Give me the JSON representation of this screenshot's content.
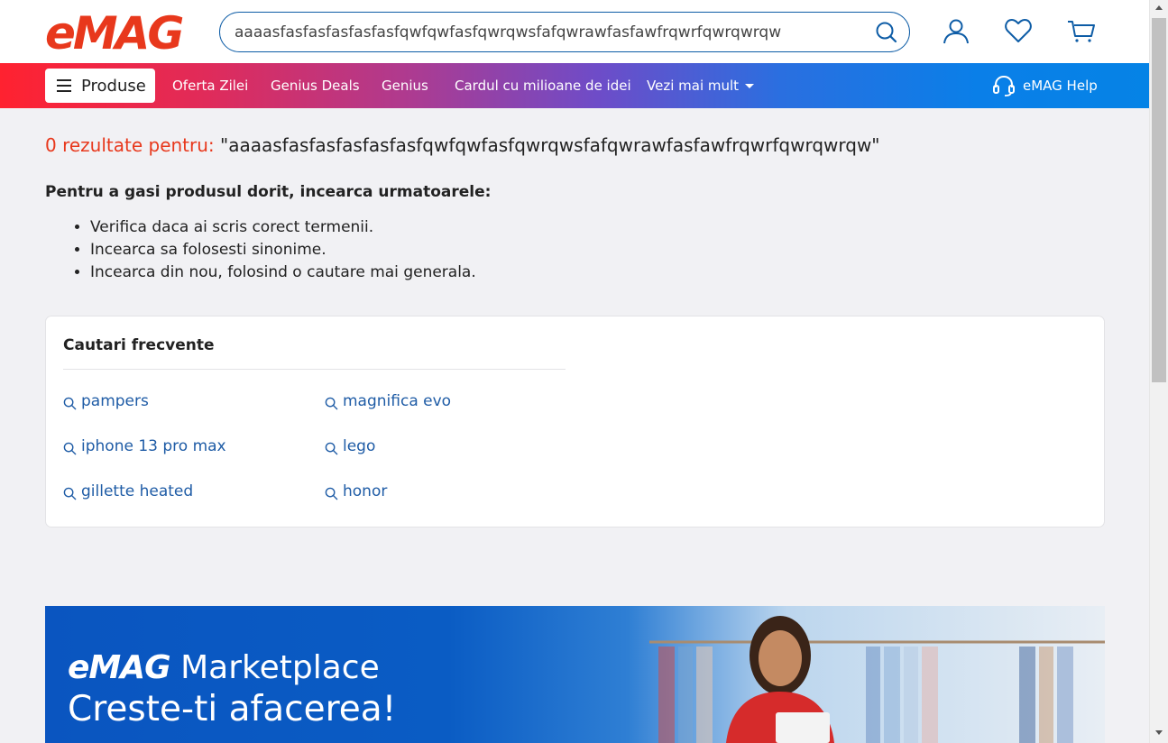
{
  "header": {
    "logo_text": "eMAG",
    "search_value": "aaaasfasfasfasfasfasfqwfqwfasfqwrqwsfafqwrawfasfawfrqwrfqwrqwrqw",
    "icons": [
      "search-icon",
      "user-icon",
      "heart-icon",
      "cart-icon"
    ]
  },
  "nav": {
    "produse": "Produse",
    "links": [
      "Oferta Zilei",
      "Genius Deals",
      "Genius",
      "Cardul cu milioane de idei",
      "Vezi mai mult"
    ],
    "help": "eMAG Help"
  },
  "results": {
    "count_label": "0 rezultate pentru:",
    "query_quoted": "\"aaaasfasfasfasfasfasfqwfqwfasfqwrqwsfafqwrawfasfawfrqwrfqwrqwrqw\""
  },
  "tips": {
    "title": "Pentru a gasi produsul dorit, incearca urmatoarele:",
    "items": [
      "Verifica daca ai scris corect termenii.",
      "Incearca sa folosesti sinonime.",
      "Incearca din nou, folosind o cautare mai generala."
    ]
  },
  "frequent": {
    "title": "Cautari frecvente",
    "items": [
      "pampers",
      "magnifica evo",
      "iphone 13 pro max",
      "lego",
      "gillette heated",
      "honor"
    ]
  },
  "banner": {
    "brand": "eMAG",
    "product": "Marketplace",
    "tagline": "Creste-ti afacerea!"
  },
  "colors": {
    "brand_red": "#e8381c",
    "link_blue": "#1f5ca6",
    "search_border": "#0d5ca6"
  }
}
